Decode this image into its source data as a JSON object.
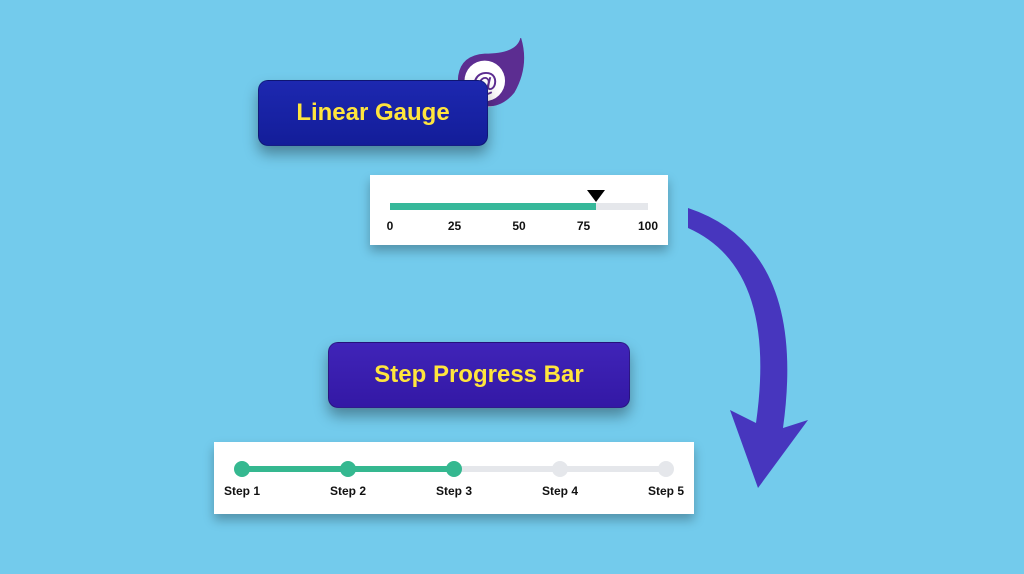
{
  "titles": {
    "linear_gauge": "Linear Gauge",
    "step_progress": "Step Progress Bar"
  },
  "colors": {
    "background": "#73cbec",
    "badge_blue": "#1d28b0",
    "badge_purple": "#3c1fb0",
    "badge_text": "#ffe53d",
    "gauge_fill": "#36b89a",
    "gauge_empty": "#e5e7eb",
    "step_done": "#35b890",
    "step_pending": "#e5e7eb",
    "arrow": "#4736be",
    "logo": "#5c2d91"
  },
  "linear_gauge": {
    "min": 0,
    "max": 100,
    "value": 80,
    "ticks": [
      0,
      25,
      50,
      75,
      100
    ]
  },
  "step_progress": {
    "current_step": 3,
    "steps": [
      {
        "label": "Step 1",
        "done": true
      },
      {
        "label": "Step 2",
        "done": true
      },
      {
        "label": "Step 3",
        "done": true
      },
      {
        "label": "Step 4",
        "done": false
      },
      {
        "label": "Step 5",
        "done": false
      }
    ]
  }
}
